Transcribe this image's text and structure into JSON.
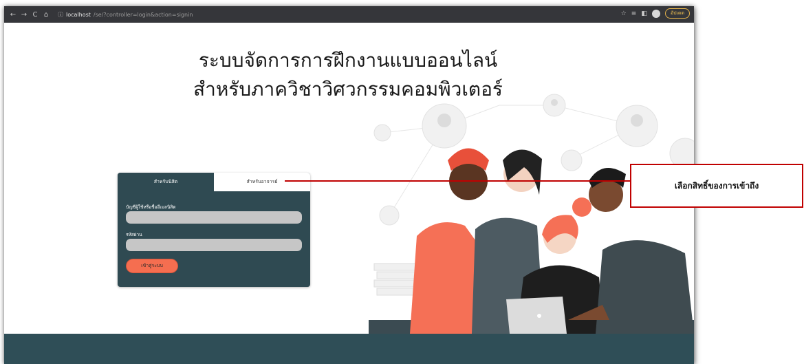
{
  "browser": {
    "back_icon": "←",
    "forward_icon": "→",
    "reload_icon": "C",
    "home_icon": "⌂",
    "info_icon": "ⓘ",
    "url_host": "localhost",
    "url_path": "/se/?controller=login&action=signin",
    "star_icon": "☆",
    "update_label": "อัปเดต"
  },
  "page": {
    "title_line1": "ระบบจัดการการฝึกงานแบบออนไลน์",
    "title_line2": "สำหรับภาควิชาวิศวกรรมคอมพิวเตอร์"
  },
  "login": {
    "tab_student": "สำหรับนิสิต",
    "tab_teacher": "สำหรับอาจารย์",
    "username_label": "บัญชีผู้ใช้หรือชื่ออีเมลนิสิต",
    "password_label": "รหัสผ่าน",
    "submit_label": "เข้าสู่ระบบ"
  },
  "annotation": {
    "text": "เลือกสิทธิ์ของการเข้าถึง"
  },
  "colors": {
    "card": "#2f4a52",
    "button": "#f56e50",
    "callout_border": "#c00000",
    "footer": "#2f4e57"
  }
}
